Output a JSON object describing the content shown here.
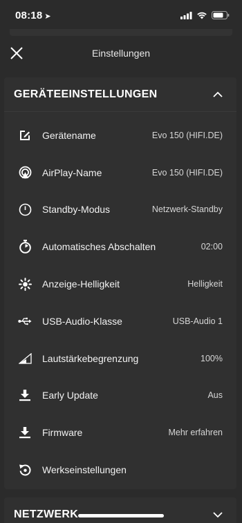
{
  "status": {
    "time": "08:18",
    "location_icon": "location-arrow-icon",
    "signal_icon": "cellular-signal-icon",
    "wifi_icon": "wifi-icon",
    "battery_icon": "battery-icon"
  },
  "header": {
    "title": "Einstellungen",
    "close_icon": "close-icon"
  },
  "device_settings": {
    "title": "GERÄTEEINSTELLUNGEN",
    "expanded": true,
    "rows": [
      {
        "icon": "edit-icon",
        "label": "Gerätename",
        "value": "Evo 150 (HIFI.DE)"
      },
      {
        "icon": "airplay-icon",
        "label": "AirPlay-Name",
        "value": "Evo 150 (HIFI.DE)"
      },
      {
        "icon": "power-icon",
        "label": "Standby-Modus",
        "value": "Netzwerk-Standby"
      },
      {
        "icon": "timer-icon",
        "label": "Automatisches Abschalten",
        "value": "02:00"
      },
      {
        "icon": "brightness-icon",
        "label": "Anzeige-Helligkeit",
        "value": "Helligkeit"
      },
      {
        "icon": "usb-icon",
        "label": "USB-Audio-Klasse",
        "value": "USB-Audio 1"
      },
      {
        "icon": "volume-limit-icon",
        "label": "Lautstärkebegrenzung",
        "value": "100%"
      },
      {
        "icon": "download-icon",
        "label": "Early Update",
        "value": "Aus"
      },
      {
        "icon": "download-icon",
        "label": "Firmware",
        "value": "Mehr erfahren"
      },
      {
        "icon": "reset-icon",
        "label": "Werkseinstellungen",
        "value": ""
      }
    ]
  },
  "network": {
    "title": "NETZWERK",
    "expanded": false
  }
}
